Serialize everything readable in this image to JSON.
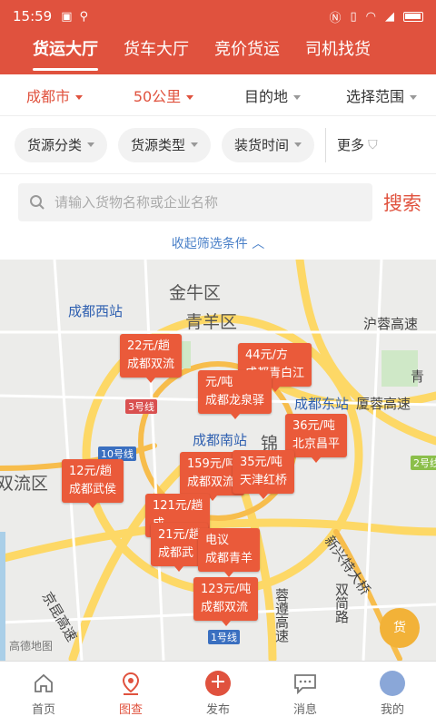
{
  "status": {
    "time": "15:59"
  },
  "tabs": [
    {
      "label": "货运大厅",
      "active": true
    },
    {
      "label": "货车大厅"
    },
    {
      "label": "竞价货运"
    },
    {
      "label": "司机找货"
    }
  ],
  "filter1": [
    {
      "label": "成都市",
      "color": "red"
    },
    {
      "label": "50公里",
      "color": "red"
    },
    {
      "label": "目的地"
    },
    {
      "label": "选择范围"
    }
  ],
  "filter2": [
    {
      "label": "货源分类"
    },
    {
      "label": "货源类型"
    },
    {
      "label": "装货时间"
    }
  ],
  "more_label": "更多",
  "search": {
    "placeholder": "请输入货物名称或企业名称",
    "button": "搜索"
  },
  "collapse_label": "收起筛选条件",
  "map": {
    "places": [
      {
        "text": "金牛区"
      },
      {
        "text": "青羊区"
      },
      {
        "text": "成都西站"
      },
      {
        "text": "沪蓉高速"
      },
      {
        "text": "成都东站"
      },
      {
        "text": "厦蓉高速"
      },
      {
        "text": "成都南站"
      },
      {
        "text": "锦"
      },
      {
        "text": "双流区"
      },
      {
        "text": "新兴特大桥"
      },
      {
        "text": "蓉遵高速"
      },
      {
        "text": "双简路"
      },
      {
        "text": "京昆高速"
      },
      {
        "text": "青"
      },
      {
        "text": "3号线"
      },
      {
        "text": "10号线"
      },
      {
        "text": "1号线"
      },
      {
        "text": "2号线"
      }
    ],
    "callouts": [
      {
        "price": "22元/趟",
        "dest": "成都双流"
      },
      {
        "price": "44元/方",
        "dest": "成都青白江"
      },
      {
        "price": "元/吨",
        "dest": "成都龙泉驿"
      },
      {
        "price": "36元/吨",
        "dest": "北京昌平"
      },
      {
        "price": "12元/趟",
        "dest": "成都武侯"
      },
      {
        "price": "159元/吨",
        "dest": "成都双流"
      },
      {
        "price": "35元/吨",
        "dest": "天津红桥"
      },
      {
        "price": "121元/趟",
        "dest": "成"
      },
      {
        "price": "21元/趟",
        "dest": "成都武"
      },
      {
        "price": "电议",
        "dest": "成都青羊"
      },
      {
        "price": "123元/吨",
        "dest": "成都双流"
      }
    ],
    "logo": "高德地图"
  },
  "nav": [
    {
      "label": "首页",
      "icon": "home-icon"
    },
    {
      "label": "图查",
      "icon": "map-pin-icon",
      "active": true
    },
    {
      "label": "发布",
      "icon": "plus-icon"
    },
    {
      "label": "消息",
      "icon": "message-icon"
    },
    {
      "label": "我的",
      "icon": "avatar-icon"
    }
  ],
  "colors": {
    "brand": "#e0523e",
    "callout": "#ea5a3a",
    "link": "#4a80c8"
  }
}
